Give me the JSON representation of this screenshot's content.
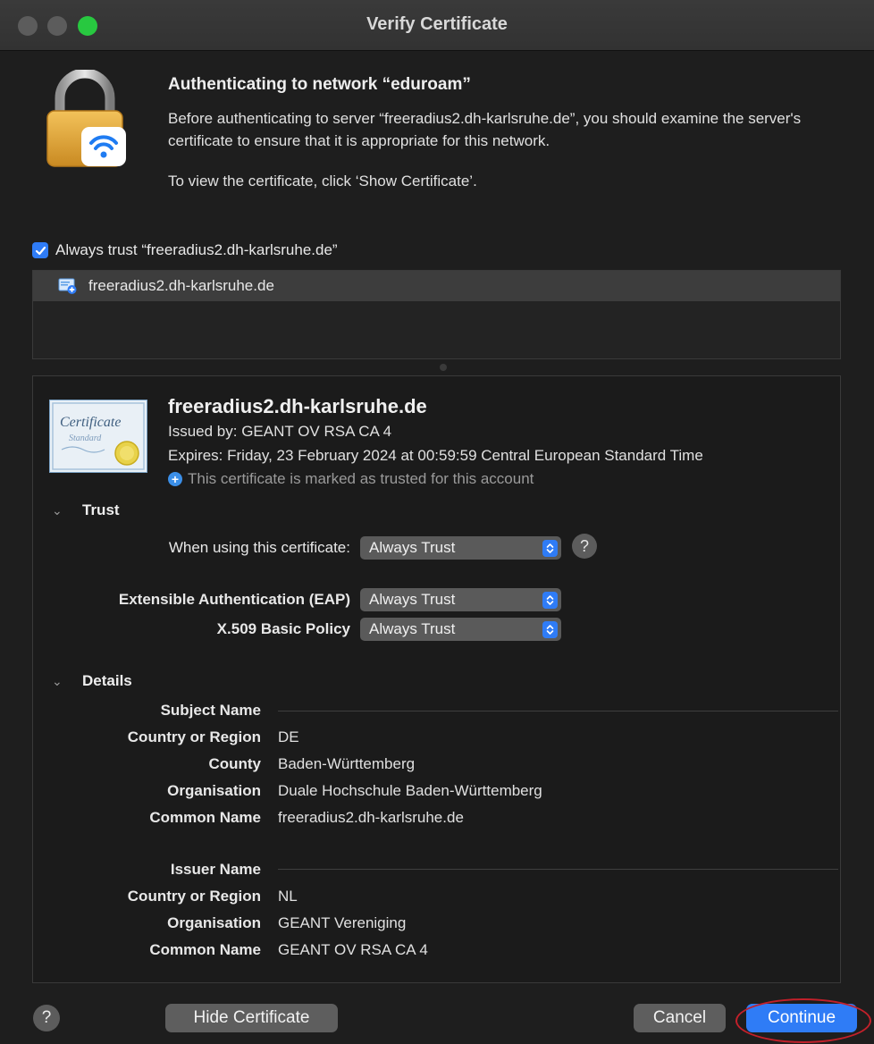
{
  "window": {
    "title": "Verify Certificate"
  },
  "header": {
    "heading": "Authenticating to network “eduroam”",
    "message": "Before authenticating to server “freeradius2.dh-karlsruhe.de”, you should examine the server's certificate to ensure that it is appropriate for this network.",
    "hint": "To view the certificate, click ‘Show Certificate’."
  },
  "always_trust": {
    "label": "Always trust “freeradius2.dh-karlsruhe.de”",
    "checked": true
  },
  "cert_list": {
    "items": [
      {
        "label": "freeradius2.dh-karlsruhe.de"
      }
    ]
  },
  "certificate": {
    "name": "freeradius2.dh-karlsruhe.de",
    "issued_by": "Issued by: GEANT OV RSA CA 4",
    "expires": "Expires: Friday, 23 February 2024 at 00:59:59 Central European Standard Time",
    "trusted_note": "This certificate is marked as trusted for this account",
    "image_text": {
      "line1": "Certificate",
      "line2": "Standard"
    }
  },
  "trust": {
    "section_label": "Trust",
    "when_using_label": "When using this certificate:",
    "when_using_value": "Always Trust",
    "eap_label": "Extensible Authentication (EAP)",
    "eap_value": "Always Trust",
    "x509_label": "X.509 Basic Policy",
    "x509_value": "Always Trust",
    "help": "?"
  },
  "details": {
    "section_label": "Details",
    "subject": {
      "header": "Subject Name",
      "rows": [
        {
          "label": "Country or Region",
          "value": "DE"
        },
        {
          "label": "County",
          "value": "Baden-Württemberg"
        },
        {
          "label": "Organisation",
          "value": "Duale Hochschule Baden-Württemberg"
        },
        {
          "label": "Common Name",
          "value": "freeradius2.dh-karlsruhe.de"
        }
      ]
    },
    "issuer": {
      "header": "Issuer Name",
      "rows": [
        {
          "label": "Country or Region",
          "value": "NL"
        },
        {
          "label": "Organisation",
          "value": "GEANT Vereniging"
        },
        {
          "label": "Common Name",
          "value": "GEANT OV RSA CA 4"
        }
      ]
    }
  },
  "footer": {
    "help": "?",
    "hide_certificate": "Hide Certificate",
    "cancel": "Cancel",
    "continue": "Continue"
  },
  "colors": {
    "accent": "#2f7cf6",
    "annotation": "#c2202a",
    "background": "#1e1e1e"
  }
}
